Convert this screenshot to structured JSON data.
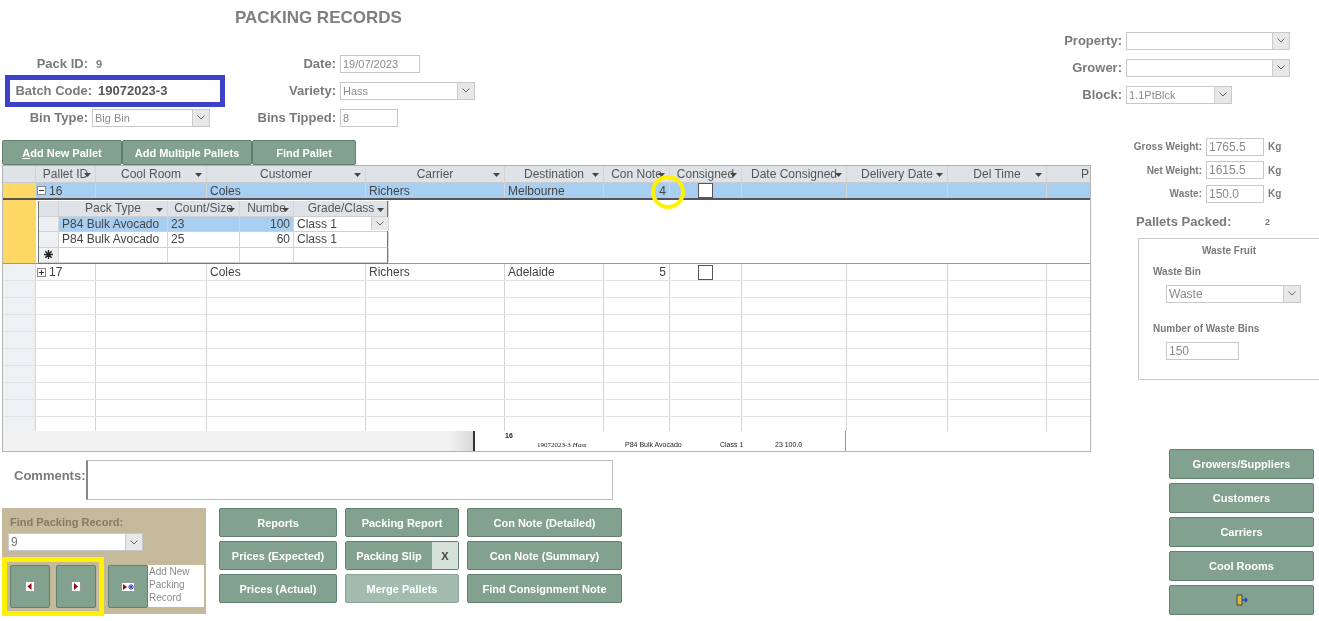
{
  "title": "PACKING RECORDS",
  "record": {
    "pack_id": {
      "label": "Pack ID:",
      "value": "9"
    },
    "date": {
      "label": "Date:",
      "value": "19/07/2023"
    },
    "batch_code": {
      "label": "Batch Code:",
      "value": "19072023-3"
    },
    "variety": {
      "label": "Variety:",
      "value": "Hass"
    },
    "bin_type": {
      "label": "Bin Type:",
      "value": "Big Bin"
    },
    "bins_tipped": {
      "label": "Bins Tipped:",
      "value": "8"
    }
  },
  "location": [
    {
      "label": "Property:"
    },
    {
      "label": "Grower:"
    },
    {
      "label": "Block:",
      "value": "1.1PtBlck"
    }
  ],
  "pallet_buttons": [
    {
      "label": "Add New Pallet",
      "access_key": true
    },
    {
      "label": "Add Multiple Pallets",
      "access_key": false
    },
    {
      "label": "Find Pallet",
      "access_key": false
    }
  ],
  "pallets": {
    "columns": [
      "Pallet ID",
      "Cool Room",
      "Customer",
      "Carrier",
      "Destination",
      "Con Note",
      "Consigned",
      "Date Consigned",
      "Delivery Date",
      "Del Time",
      "P"
    ],
    "rows": [
      {
        "pallet_id": "16",
        "customer": "Coles",
        "carrier": "Richers",
        "destination": "Melbourne",
        "con_note": "4",
        "consigned": false,
        "expanded": true,
        "selected": true,
        "items": {
          "columns": [
            "Pack Type",
            "Count/Size",
            "Numbe",
            "Grade/Class"
          ],
          "rows": [
            {
              "pack_type": "P84 Bulk Avocado",
              "count_size": "23",
              "number": "100",
              "grade_class": "Class 1",
              "selected": true
            },
            {
              "pack_type": "P84 Bulk Avocado",
              "count_size": "25",
              "number": "60",
              "grade_class": "Class 1",
              "selected": false
            }
          ]
        }
      },
      {
        "pallet_id": "17",
        "customer": "Coles",
        "carrier": "Richers",
        "destination": "Adelaide",
        "con_note": "5",
        "consigned": false,
        "expanded": false,
        "selected": false
      }
    ]
  },
  "report_preview": {
    "pallet": "16",
    "batch": "19072023-3",
    "variety": "Hass",
    "pack_type": "P84 Bulk Avocado",
    "grade": "Class 1",
    "figures": "23 100.0"
  },
  "weights": [
    {
      "label": "Gross Weight:",
      "value": "1765.5",
      "unit": "Kg"
    },
    {
      "label": "Net Weight:",
      "value": "1615.5",
      "unit": "Kg"
    },
    {
      "label": "Waste:",
      "value": "150.0",
      "unit": "Kg"
    }
  ],
  "pallets_packed": {
    "label": "Pallets Packed:",
    "value": "2"
  },
  "waste_fruit": {
    "title": "Waste Fruit",
    "bin_label": "Waste Bin",
    "bin_value": "Waste",
    "count_label": "Number of Waste Bins",
    "count_value": "150"
  },
  "comments": {
    "label": "Comments:"
  },
  "find_record": {
    "label": "Find Packing Record:",
    "value": "9",
    "new_label": "Add New Packing Record"
  },
  "action_buttons": [
    {
      "label": "Reports",
      "kind": "plain",
      "disabled": false
    },
    {
      "label": "Packing Report",
      "kind": "plain",
      "disabled": false
    },
    {
      "label": "Con Note (Detailed)",
      "kind": "plain",
      "disabled": false
    },
    {
      "label": "Prices (Expected)",
      "kind": "plain",
      "disabled": false
    },
    {
      "label": "Packing Slip",
      "kind": "split",
      "extra": "X",
      "disabled": false
    },
    {
      "label": "Con Note (Summary)",
      "kind": "plain",
      "disabled": false
    },
    {
      "label": "Prices (Actual)",
      "kind": "plain",
      "disabled": false
    },
    {
      "label": "Merge Pallets",
      "kind": "plain",
      "disabled": true
    },
    {
      "label": "Find Consignment Note",
      "kind": "plain",
      "disabled": false
    }
  ],
  "side_buttons": [
    "Growers/Suppliers",
    "Customers",
    "Carriers",
    "Cool Rooms"
  ]
}
